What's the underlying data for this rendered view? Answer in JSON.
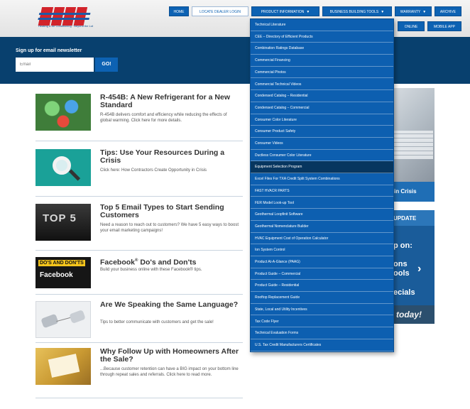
{
  "brand": {
    "tagline": "Heating & Air Conditioning · Beyond the Lot",
    "colors": {
      "primary": "#0d62b3",
      "dark": "#08406e",
      "logo_red": "#d2232a"
    }
  },
  "nav": {
    "home": "HOME",
    "locator": "LOCATE DEALER LOGIN",
    "product_info": "PRODUCT INFORMATION",
    "business_tools": "BUSINESS BUILDING TOOLS",
    "warranty": "WARRANTY",
    "archive": "ARCHIVE",
    "caret": "▼",
    "sub_online": "ONLINE",
    "sub_mobile": "MOBILE APP"
  },
  "newsletter": {
    "title": "Sign up for email newsletter",
    "placeholder": "Email",
    "button": "GO!"
  },
  "articles": [
    {
      "title": "R-454B: A New Refrigerant for a New Standard",
      "desc": "R-454B delivers comfort and efficiency while reducing the effects of global warming. Click here for more details."
    },
    {
      "title": "Tips: Use Your Resources During a Crisis",
      "desc": "Click here: How Contractors Create Opportunity in Crisis"
    },
    {
      "title": "Top 5 Email Types to Start Sending Customers",
      "desc": "Need a reason to reach out to customers? We have 5 easy ways to boost your email marketing campaigns!"
    },
    {
      "title": "Facebook",
      "title_sup": "®",
      "title_rest": " Do's and Don'ts",
      "desc": "Build your business online with these Facebook® tips."
    },
    {
      "title": "Are We Speaking the Same Language?",
      "desc": "Tips to better communicate with customers and get the sale!"
    },
    {
      "title": "Why Follow Up with Homeowners After the Sale?",
      "desc": "...Because customer retention can have a BIG impact on your bottom line through repeat sales and referrals. Click here to read more."
    }
  ],
  "thumbs": {
    "top5": "TOP 5",
    "dos_donts": "DO'S AND DON'TS",
    "facebook": "Facebook"
  },
  "promo": {
    "crisis": "in Crisis",
    "update": "UPDATE",
    "line2": "p on:",
    "line3a": "ons",
    "line3b": "ools",
    "arrow": "›",
    "line4": "ecials",
    "today": "today!"
  },
  "dropdown": {
    "items": [
      "Technical Literature",
      "CEE – Directory of Efficient Products",
      "Combination Ratings Database",
      "Commercial Financing",
      "Commercial Photos",
      "Commercial Technical Videos",
      "Condensed Catalog – Residential",
      "Condensed Catalog – Commercial",
      "Consumer Color Literature",
      "Consumer Product Safety",
      "Consumer Videos",
      "Ductless Consumer Color Literature",
      "Equipment Selection Program",
      "Excel Files For TXA Credit Split System Combinations",
      "FAST HVACR PARTS",
      "FER Model Look-up Tool",
      "Geothermal Loopfinit Software",
      "Geothermal Nomenclature Builder",
      "HVAC Equipment Cost of Operation Calculator",
      "Ion System Control",
      "Product At-A-Glance (PAAG)",
      "Product Guide – Commercial",
      "Product Guide – Residential",
      "Rooftop Replacement Guide",
      "State, Local and Utility Incentives",
      "Tax Code Flyer",
      "Technical Evaluation Forms",
      "U.S. Tax Credit Manufacturers Certificates"
    ],
    "active_index": 12
  }
}
